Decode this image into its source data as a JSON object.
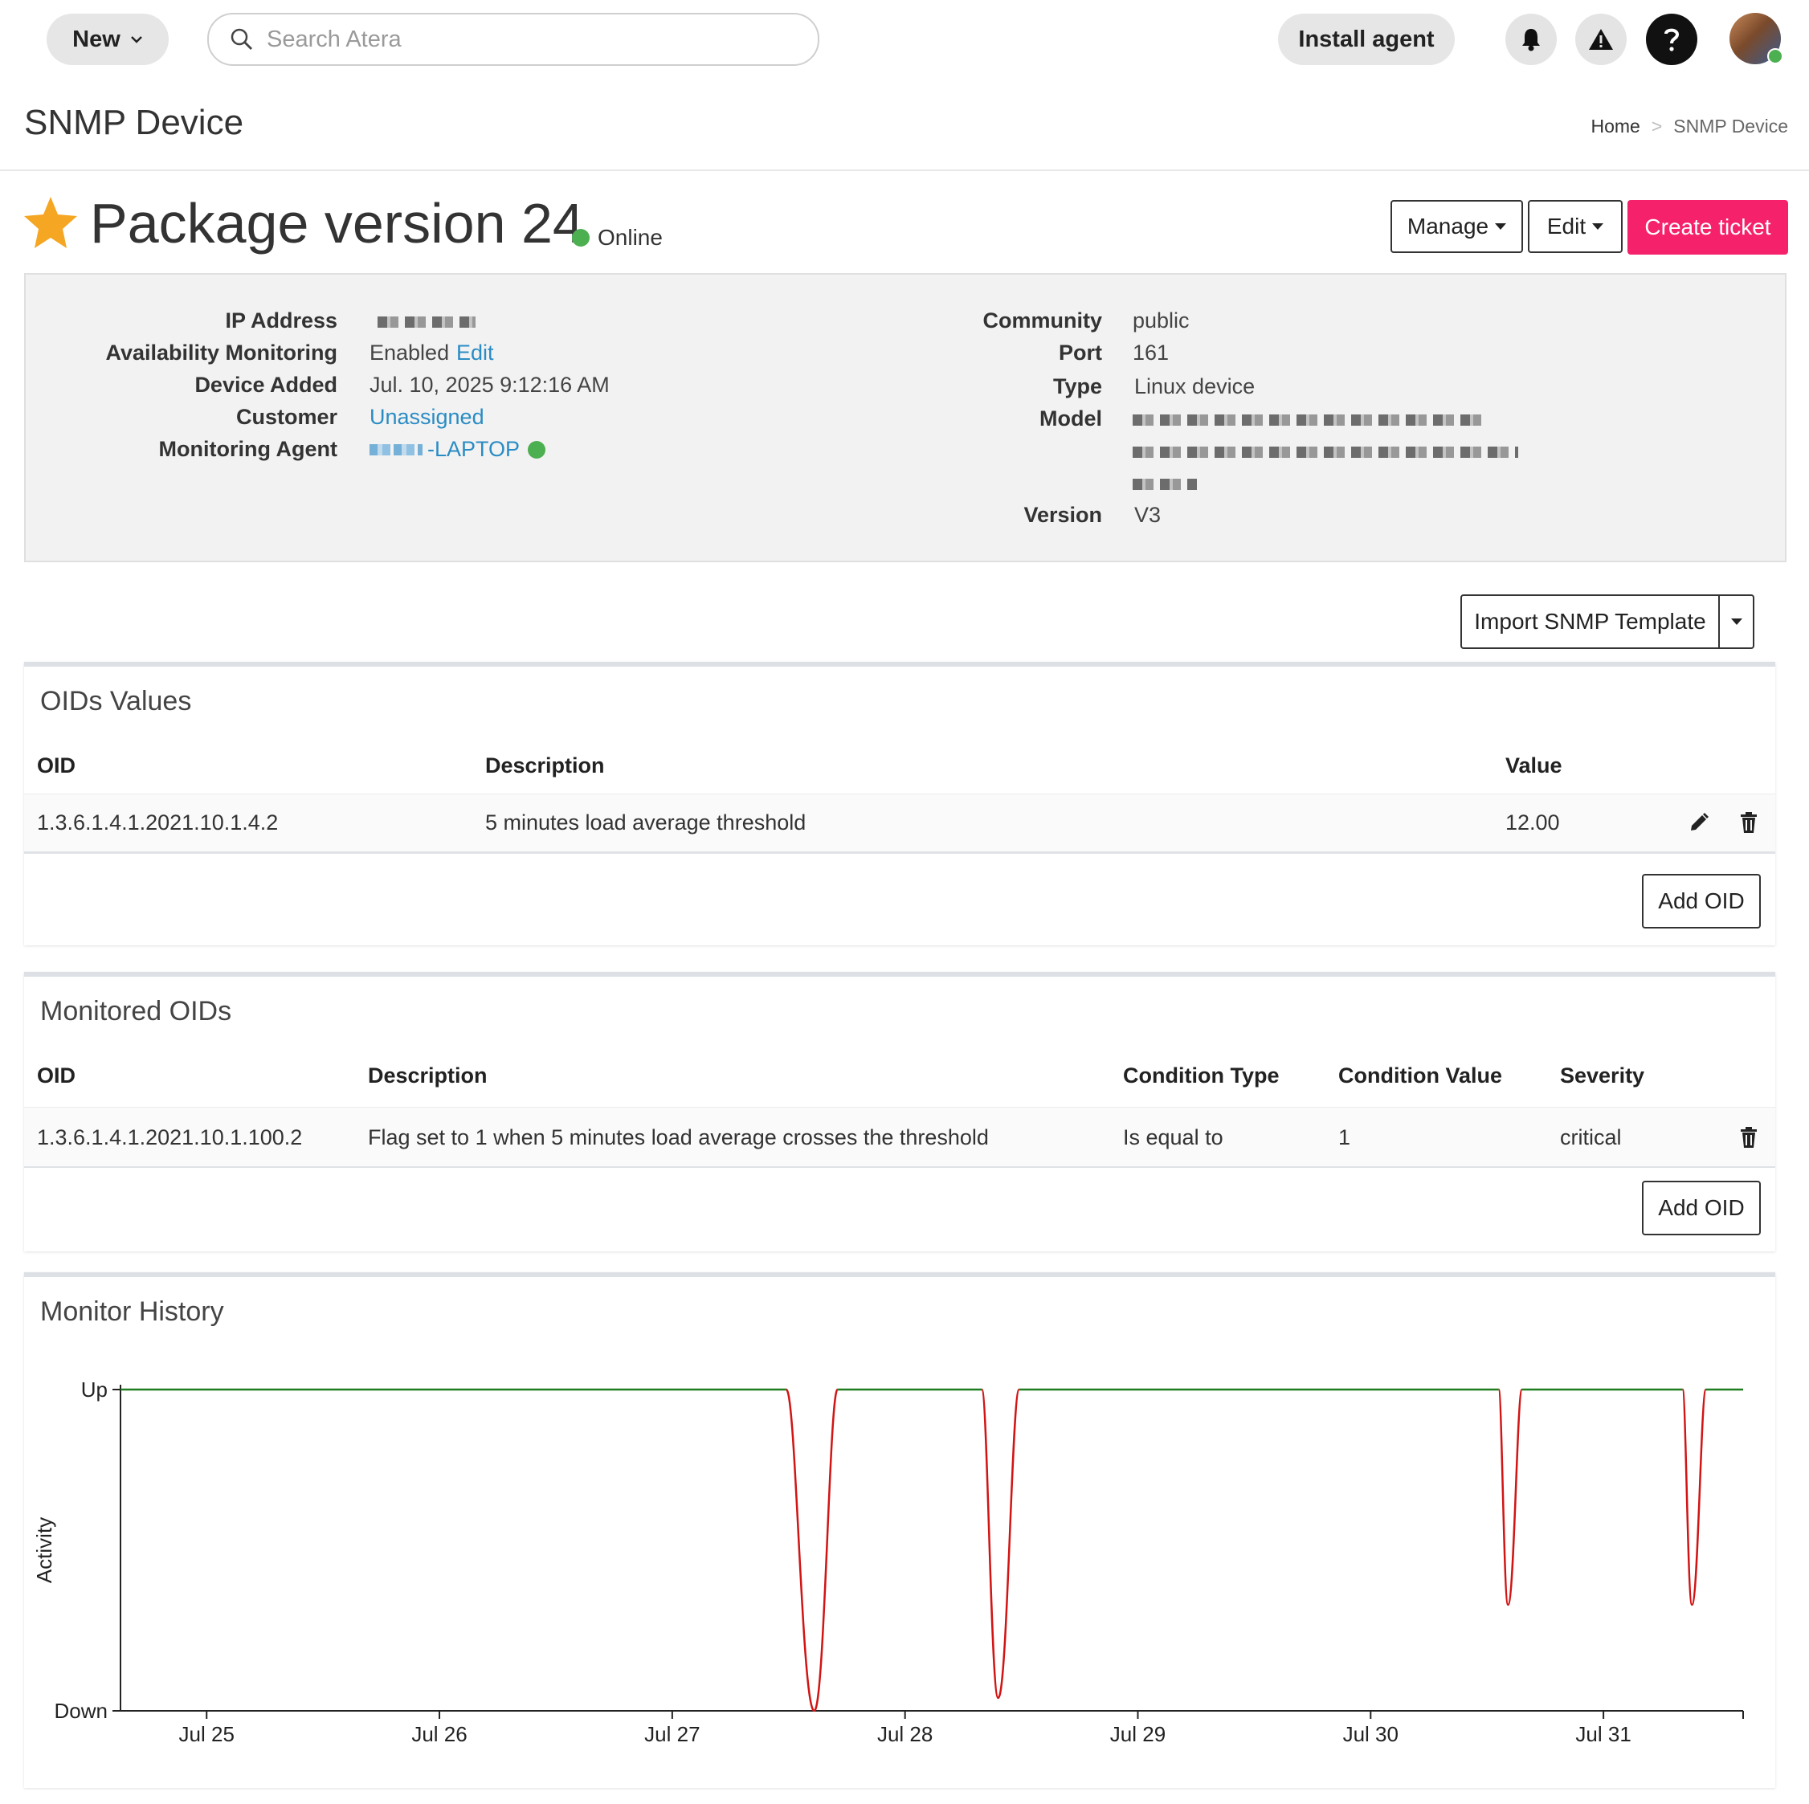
{
  "topbar": {
    "new_label": "New",
    "search_placeholder": "Search Atera",
    "install_label": "Install agent"
  },
  "header": {
    "page_title": "SNMP Device",
    "breadcrumb": [
      "Home",
      ">",
      "SNMP Device"
    ]
  },
  "device": {
    "name": "Package version 24",
    "status": "Online",
    "manage_label": "Manage",
    "edit_label": "Edit",
    "create_ticket_label": "Create ticket"
  },
  "info_left": {
    "ip_label": "IP Address",
    "availability_label": "Availability Monitoring",
    "availability_value": "Enabled",
    "availability_edit": "Edit",
    "added_label": "Device Added",
    "added_value": "Jul. 10, 2025 9:12:16 AM",
    "customer_label": "Customer",
    "customer_value": "Unassigned",
    "agent_label": "Monitoring Agent",
    "agent_suffix": "-LAPTOP"
  },
  "info_right": {
    "community_label": "Community",
    "community_value": "public",
    "port_label": "Port",
    "port_value": "161",
    "type_label": "Type",
    "type_value": "Linux device",
    "model_label": "Model",
    "version_label": "Version",
    "version_value": "V3"
  },
  "import_label": "Import SNMP Template",
  "oids_values": {
    "title": "OIDs Values",
    "columns": [
      "OID",
      "Description",
      "Value"
    ],
    "rows": [
      {
        "oid": "1.3.6.1.4.1.2021.10.1.4.2",
        "description": "5 minutes load average threshold",
        "value": "12.00"
      }
    ],
    "add_label": "Add OID"
  },
  "monitored_oids": {
    "title": "Monitored OIDs",
    "columns": [
      "OID",
      "Description",
      "Condition Type",
      "Condition Value",
      "Severity"
    ],
    "rows": [
      {
        "oid": "1.3.6.1.4.1.2021.10.1.100.2",
        "description": "Flag set to 1 when 5 minutes load average crosses the threshold",
        "condition_type": "Is equal to",
        "condition_value": "1",
        "severity": "critical"
      }
    ],
    "add_label": "Add OID"
  },
  "monitor_history": {
    "title": "Monitor History"
  },
  "chart_data": {
    "type": "line",
    "title": "",
    "xlabel": "",
    "ylabel": "Activity",
    "y_ticks": [
      "Down",
      "Up"
    ],
    "x_ticks": [
      "Jul 25",
      "Jul 26",
      "Jul 27",
      "Jul 28",
      "Jul 29",
      "Jul 30",
      "Jul 31"
    ],
    "xlim_days": [
      24.63,
      31.6
    ],
    "ylim": [
      0,
      1
    ],
    "grid": false,
    "colors": {
      "up": "#1e7d1e",
      "down": "#d11414"
    },
    "dips": [
      {
        "start": 27.49,
        "min_at": 27.61,
        "end": 27.71,
        "min_value": 0.0
      },
      {
        "start": 28.33,
        "min_at": 28.4,
        "end": 28.49,
        "min_value": 0.04
      },
      {
        "start": 30.55,
        "min_at": 30.59,
        "end": 30.65,
        "min_value": 0.33
      },
      {
        "start": 31.34,
        "min_at": 31.38,
        "end": 31.44,
        "min_value": 0.33
      }
    ]
  },
  "colors": {
    "accent": "#f5226b",
    "link": "#2a8cc4",
    "online": "#4caf50",
    "star": "#f5a623"
  }
}
